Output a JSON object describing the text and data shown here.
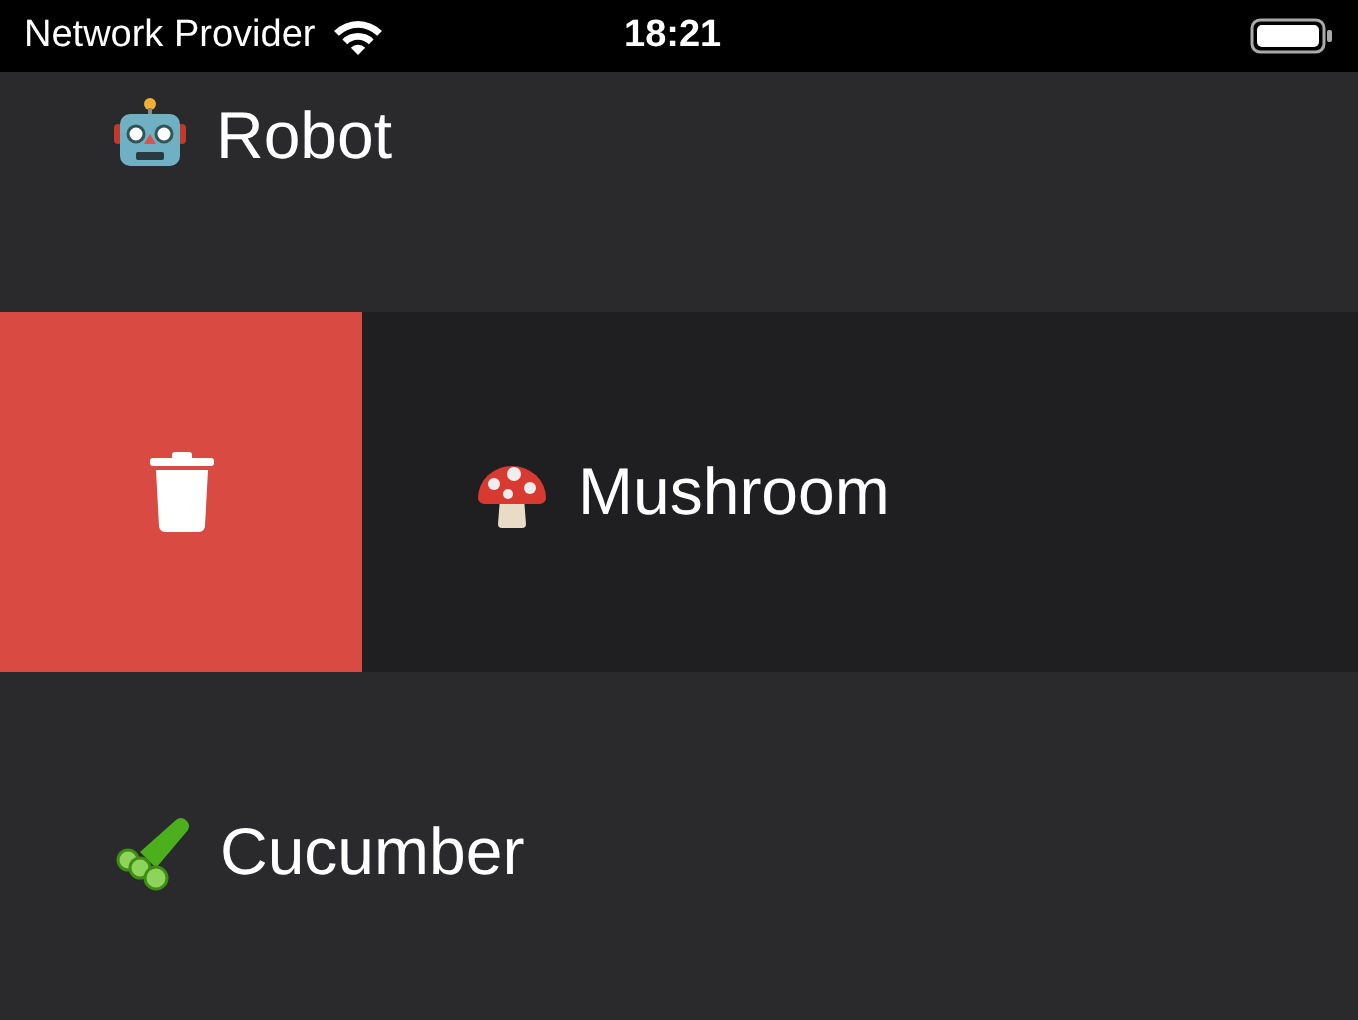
{
  "status_bar": {
    "carrier": "Network Provider",
    "time": "18:21"
  },
  "rows": [
    {
      "label": "Robot",
      "swiped": false
    },
    {
      "label": "Mushroom",
      "swiped": true
    },
    {
      "label": "Cucumber",
      "swiped": false
    }
  ]
}
